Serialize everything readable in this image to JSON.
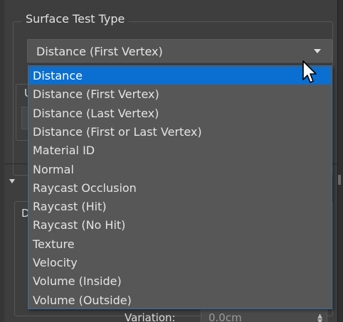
{
  "group": {
    "title": "Surface Test Type"
  },
  "combo": {
    "selected": "Distance (First Vertex)",
    "arrow_icon": "chevron-down-icon"
  },
  "dropdown": {
    "items": [
      {
        "label": "Distance",
        "selected": true
      },
      {
        "label": "Distance (First Vertex)",
        "selected": false
      },
      {
        "label": "Distance (Last Vertex)",
        "selected": false
      },
      {
        "label": "Distance (First or Last Vertex)",
        "selected": false
      },
      {
        "label": "Material ID",
        "selected": false
      },
      {
        "label": "Normal",
        "selected": false
      },
      {
        "label": "Raycast Occlusion",
        "selected": false
      },
      {
        "label": "Raycast (Hit)",
        "selected": false
      },
      {
        "label": "Raycast (No Hit)",
        "selected": false
      },
      {
        "label": "Texture",
        "selected": false
      },
      {
        "label": "Velocity",
        "selected": false
      },
      {
        "label": "Volume (Inside)",
        "selected": false
      },
      {
        "label": "Volume (Outside)",
        "selected": false
      }
    ],
    "highlight_color": "#0b6fd1"
  },
  "background": {
    "sub_group_letter": "U",
    "rollout_letter": "D",
    "variation_label": "Variation:",
    "variation_value": "0.0cm"
  },
  "colors": {
    "panel_bg": "#3e3e3e",
    "dropdown_bg": "#575757",
    "dropdown_border": "#3a6ea8"
  }
}
